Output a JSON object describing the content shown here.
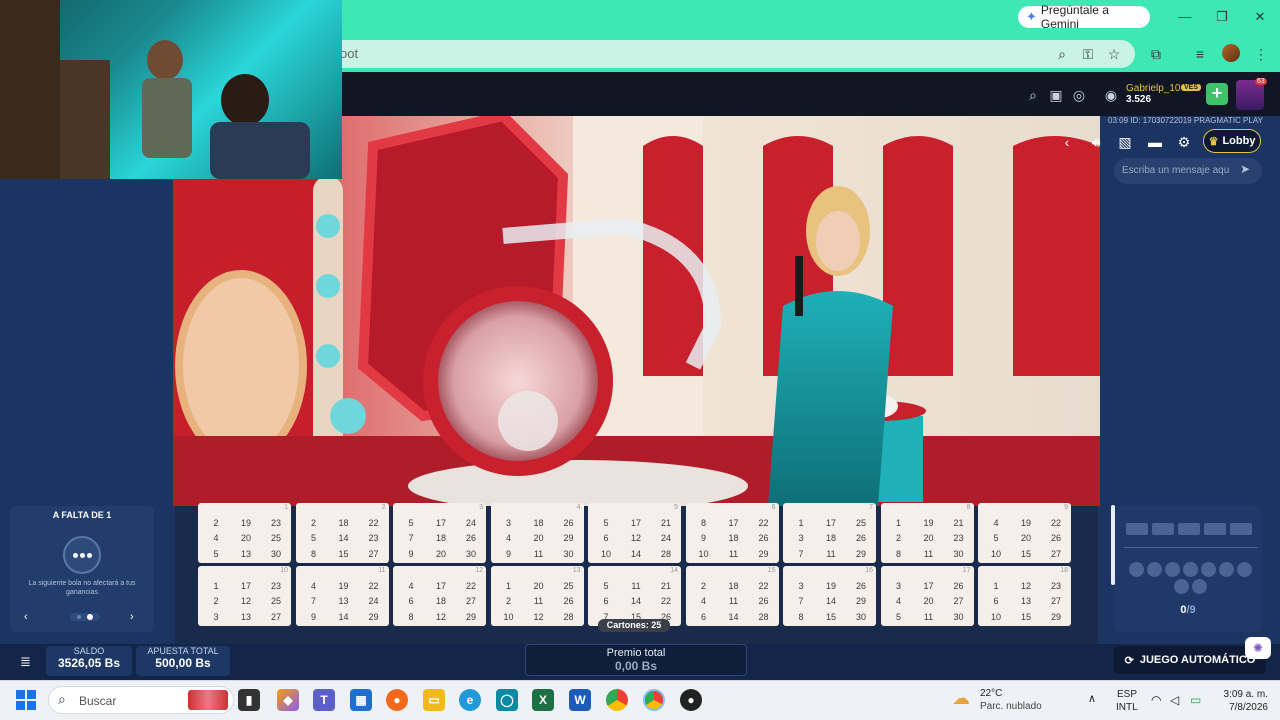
{
  "browser": {
    "gemini_label": "Pregúntale a Gemini",
    "address_text": "oot"
  },
  "game_header": {
    "user_name": "Gabrielp_10",
    "currency_badge": "VES",
    "balance": "3.526",
    "promo_count": "63"
  },
  "right_header": {
    "round_id": "03:09 ID: 17030722019 PRAGMATIC PLAY",
    "lobby_label": "Lobby",
    "chat_placeholder": "Escriba un mensaje aqu"
  },
  "falta": {
    "title": "A FALTA DE 1",
    "note": "La siguiente bola no afectará a tus ganancias"
  },
  "cards": [
    {
      "id": "1",
      "rows": [
        [
          "2",
          "19",
          "23"
        ],
        [
          "4",
          "20",
          "25"
        ],
        [
          "5",
          "13",
          "30"
        ]
      ]
    },
    {
      "id": "2",
      "rows": [
        [
          "2",
          "18",
          "22"
        ],
        [
          "5",
          "14",
          "23"
        ],
        [
          "8",
          "15",
          "27"
        ]
      ]
    },
    {
      "id": "3",
      "rows": [
        [
          "5",
          "17",
          "24"
        ],
        [
          "7",
          "18",
          "26"
        ],
        [
          "9",
          "20",
          "30"
        ]
      ]
    },
    {
      "id": "4",
      "rows": [
        [
          "3",
          "18",
          "26"
        ],
        [
          "4",
          "20",
          "29"
        ],
        [
          "9",
          "11",
          "30"
        ]
      ]
    },
    {
      "id": "5",
      "rows": [
        [
          "5",
          "17",
          "21"
        ],
        [
          "6",
          "12",
          "24"
        ],
        [
          "10",
          "14",
          "28"
        ]
      ]
    },
    {
      "id": "6",
      "rows": [
        [
          "8",
          "17",
          "22"
        ],
        [
          "9",
          "18",
          "26"
        ],
        [
          "10",
          "11",
          "29"
        ]
      ]
    },
    {
      "id": "7",
      "rows": [
        [
          "1",
          "17",
          "25"
        ],
        [
          "3",
          "18",
          "26"
        ],
        [
          "7",
          "11",
          "29"
        ]
      ]
    },
    {
      "id": "8",
      "rows": [
        [
          "1",
          "19",
          "21"
        ],
        [
          "2",
          "20",
          "23"
        ],
        [
          "8",
          "11",
          "30"
        ]
      ]
    },
    {
      "id": "9",
      "rows": [
        [
          "4",
          "19",
          "22"
        ],
        [
          "5",
          "20",
          "26"
        ],
        [
          "10",
          "15",
          "27"
        ]
      ]
    },
    {
      "id": "10",
      "rows": [
        [
          "1",
          "17",
          "23"
        ],
        [
          "2",
          "12",
          "25"
        ],
        [
          "3",
          "13",
          "27"
        ]
      ]
    },
    {
      "id": "11",
      "rows": [
        [
          "4",
          "19",
          "22"
        ],
        [
          "7",
          "13",
          "24"
        ],
        [
          "9",
          "14",
          "29"
        ]
      ]
    },
    {
      "id": "12",
      "rows": [
        [
          "4",
          "17",
          "22"
        ],
        [
          "6",
          "18",
          "27"
        ],
        [
          "8",
          "12",
          "29"
        ]
      ]
    },
    {
      "id": "13",
      "rows": [
        [
          "1",
          "20",
          "25"
        ],
        [
          "2",
          "11",
          "26"
        ],
        [
          "10",
          "12",
          "28"
        ]
      ]
    },
    {
      "id": "14",
      "rows": [
        [
          "5",
          "11",
          "21"
        ],
        [
          "6",
          "14",
          "22"
        ],
        [
          "7",
          "15",
          "26"
        ]
      ]
    },
    {
      "id": "15",
      "rows": [
        [
          "2",
          "18",
          "22"
        ],
        [
          "4",
          "11",
          "26"
        ],
        [
          "6",
          "14",
          "28"
        ]
      ]
    },
    {
      "id": "16",
      "rows": [
        [
          "3",
          "19",
          "26"
        ],
        [
          "7",
          "14",
          "29"
        ],
        [
          "8",
          "15",
          "30"
        ]
      ]
    },
    {
      "id": "17",
      "rows": [
        [
          "3",
          "17",
          "26"
        ],
        [
          "4",
          "20",
          "27"
        ],
        [
          "5",
          "11",
          "30"
        ]
      ]
    },
    {
      "id": "18",
      "rows": [
        [
          "1",
          "12",
          "23"
        ],
        [
          "6",
          "13",
          "27"
        ],
        [
          "10",
          "15",
          "29"
        ]
      ]
    }
  ],
  "cartones_label": "Cartones: 25",
  "tracker": {
    "count": "0",
    "total": "/9"
  },
  "bottom": {
    "saldo_label": "SALDO",
    "saldo_value": "3526,05 Bs",
    "apuesta_label": "APUESTA TOTAL",
    "apuesta_value": "500,00 Bs",
    "premio_label": "Premio total",
    "premio_value": "0,00 Bs",
    "auto_label": "JUEGO AUTOMÁTICO"
  },
  "taskbar": {
    "search_label": "Buscar",
    "weather_temp": "22°C",
    "weather_desc": "Parc. nublado",
    "lang_1": "ESP",
    "lang_2": "INTL",
    "time": "3:09 a. m.",
    "date": "7/8/2026"
  },
  "colors": {
    "browser_accent": "#3de8b5",
    "game_panel": "#1c3461",
    "gold": "#e5c14a",
    "add_green": "#3ec26a"
  }
}
